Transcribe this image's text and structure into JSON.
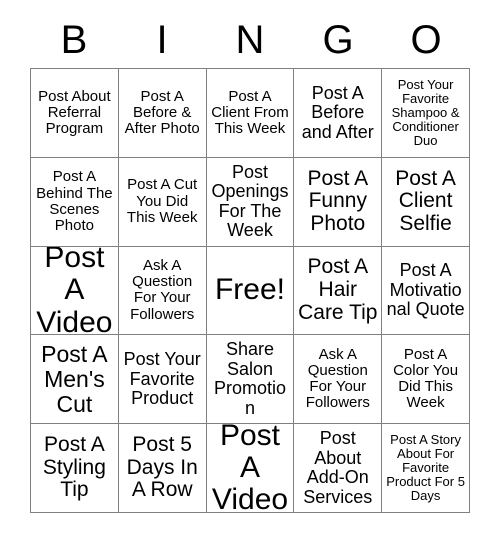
{
  "card": {
    "title": "BINGO Card",
    "header_letters": [
      "B",
      "I",
      "N",
      "G",
      "O"
    ],
    "grid_size": "5x5"
  },
  "cells": [
    {
      "id": "b1",
      "column": "B",
      "row": 1,
      "text": "Post About Referral Program",
      "free_space": false
    },
    {
      "id": "i1",
      "column": "I",
      "row": 1,
      "text": "Post A Before & After Photo",
      "free_space": false
    },
    {
      "id": "n1",
      "column": "N",
      "row": 1,
      "text": "Post A Client From This Week",
      "free_space": false
    },
    {
      "id": "g1",
      "column": "G",
      "row": 1,
      "text": "Post A Before and After",
      "free_space": false
    },
    {
      "id": "o1",
      "column": "O",
      "row": 1,
      "text": "Post Your Favorite Shampoo & Conditioner Duo",
      "free_space": false
    },
    {
      "id": "b2",
      "column": "B",
      "row": 2,
      "text": "Post A Behind The Scenes Photo",
      "free_space": false
    },
    {
      "id": "i2",
      "column": "I",
      "row": 2,
      "text": "Post A Cut You Did This Week",
      "free_space": false
    },
    {
      "id": "n2",
      "column": "N",
      "row": 2,
      "text": "Post Openings For The Week",
      "free_space": false
    },
    {
      "id": "g2",
      "column": "G",
      "row": 2,
      "text": "Post A Funny Photo",
      "free_space": false
    },
    {
      "id": "o2",
      "column": "O",
      "row": 2,
      "text": "Post A Client Selfie",
      "free_space": false
    },
    {
      "id": "b3",
      "column": "B",
      "row": 3,
      "text": "Post A Video",
      "free_space": false
    },
    {
      "id": "i3",
      "column": "I",
      "row": 3,
      "text": "Ask A Question For Your Followers",
      "free_space": false
    },
    {
      "id": "n3",
      "column": "N",
      "row": 3,
      "text": "Free!",
      "free_space": true
    },
    {
      "id": "g3",
      "column": "G",
      "row": 3,
      "text": "Post A Hair Care Tip",
      "free_space": false
    },
    {
      "id": "o3",
      "column": "O",
      "row": 3,
      "text": "Post A Motivational Quote",
      "free_space": false
    },
    {
      "id": "b4",
      "column": "B",
      "row": 4,
      "text": "Post A Men's Cut",
      "free_space": false
    },
    {
      "id": "i4",
      "column": "I",
      "row": 4,
      "text": "Post Your Favorite Product",
      "free_space": false
    },
    {
      "id": "n4",
      "column": "N",
      "row": 4,
      "text": "Share Salon Promotion",
      "free_space": false
    },
    {
      "id": "g4",
      "column": "G",
      "row": 4,
      "text": "Ask A Question For Your Followers",
      "free_space": false
    },
    {
      "id": "o4",
      "column": "O",
      "row": 4,
      "text": "Post A Color You Did This Week",
      "free_space": false
    },
    {
      "id": "b5",
      "column": "B",
      "row": 5,
      "text": "Post A Styling Tip",
      "free_space": false
    },
    {
      "id": "i5",
      "column": "I",
      "row": 5,
      "text": "Post 5 Days In A Row",
      "free_space": false
    },
    {
      "id": "n5",
      "column": "N",
      "row": 5,
      "text": "Post A Video",
      "free_space": false
    },
    {
      "id": "g5",
      "column": "G",
      "row": 5,
      "text": "Post About Add-On Services",
      "free_space": false
    },
    {
      "id": "o5",
      "column": "O",
      "row": 5,
      "text": "Post A Story About For Favorite Product For 5 Days",
      "free_space": false
    }
  ],
  "colors": {
    "background": "#ffffff",
    "text": "#000000",
    "grid_line": "#808080"
  }
}
